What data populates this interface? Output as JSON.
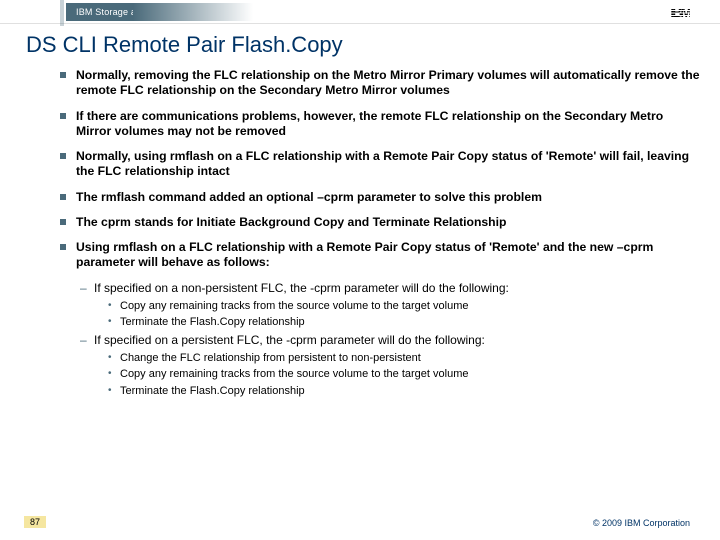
{
  "header": {
    "group": "IBM Storage and Technology Group",
    "logo": "IBM"
  },
  "title": "DS CLI Remote Pair Flash.Copy",
  "bullets": [
    {
      "level": 1,
      "text": "Normally, removing the FLC relationship on the Metro Mirror Primary volumes will automatically remove the remote FLC relationship on the Secondary Metro Mirror volumes"
    },
    {
      "level": 1,
      "text": "If there are communications problems, however, the remote FLC relationship on the Secondary Metro Mirror volumes may not be removed"
    },
    {
      "level": 1,
      "text": "Normally, using rmflash on a FLC relationship with a Remote Pair Copy status of 'Remote' will fail, leaving the FLC relationship intact"
    },
    {
      "level": 1,
      "text": "The rmflash command added an optional –cprm parameter to solve this problem"
    },
    {
      "level": 1,
      "text": "The cprm stands for Initiate Background Copy and Terminate Relationship"
    },
    {
      "level": 1,
      "text": "Using rmflash on a FLC relationship with a Remote Pair Copy status of 'Remote' and the new –cprm parameter will behave as follows:"
    },
    {
      "level": 2,
      "text": "If specified on a non-persistent FLC, the -cprm parameter will do the following:"
    },
    {
      "level": 3,
      "text": "Copy any remaining tracks from the source volume to the target volume"
    },
    {
      "level": 3,
      "text": "Terminate the Flash.Copy relationship"
    },
    {
      "level": 2,
      "text": "If specified on a persistent FLC, the -cprm parameter will do the following:"
    },
    {
      "level": 3,
      "text": "Change the FLC relationship from persistent to non-persistent"
    },
    {
      "level": 3,
      "text": "Copy any remaining tracks from the source volume to the target volume"
    },
    {
      "level": 3,
      "text": "Terminate the Flash.Copy relationship"
    }
  ],
  "footer": {
    "page": "87",
    "copyright": "© 2009 IBM Corporation"
  }
}
